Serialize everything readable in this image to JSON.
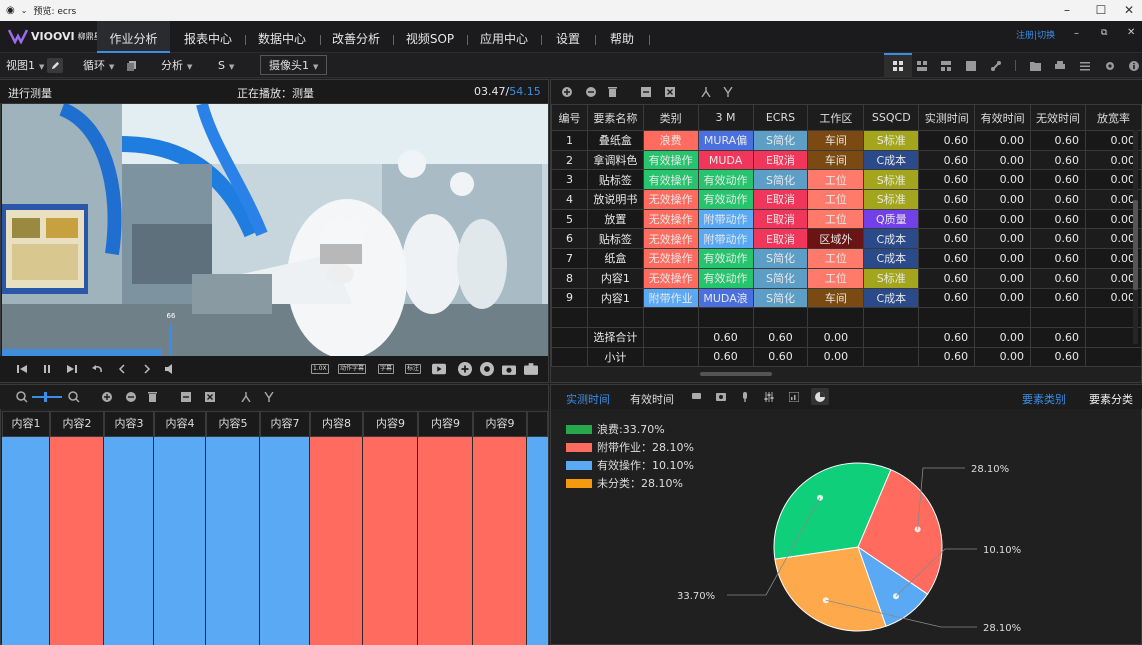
{
  "window": {
    "title": "预览: ecrs"
  },
  "app": {
    "logo_text": "VIOOVI",
    "logo_sub": "柳鼎星"
  },
  "menu": [
    "作业分析",
    "报表中心",
    "数据中心",
    "改善分析",
    "视频SOP",
    "应用中心",
    "设置",
    "帮助"
  ],
  "account": {
    "register": "注册",
    "sep": "|",
    "logout": "切换"
  },
  "toolbar": {
    "view": "视图1",
    "loop": "循环",
    "analysis": "分析",
    "s": "S",
    "camera": "摄像头1"
  },
  "video": {
    "left_label": "进行测量",
    "status": "正在播放：测量",
    "time_current": "03.47",
    "time_sep": "/",
    "time_total": "54.15",
    "scrub_value": "66",
    "speed_tag": "1.0X",
    "tags": [
      "动作字幕",
      "字幕",
      "标注"
    ]
  },
  "table": {
    "headers": [
      "编号",
      "要素名称",
      "类别",
      "3 M",
      "ECRS",
      "工作区",
      "SSQCD",
      "实测时间",
      "有效时间",
      "无效时间",
      "放宽率"
    ],
    "rows": [
      {
        "no": "1",
        "name": "叠纸盒",
        "cat": "浪费",
        "m3": "MURA偏",
        "ecrs": "S简化",
        "area": "车间",
        "ssqcd": "S标准",
        "t1": "0.60",
        "t2": "0.00",
        "t3": "0.60",
        "t4": "0.00"
      },
      {
        "no": "2",
        "name": "拿调料色",
        "cat": "有效操作",
        "m3": "MUDA",
        "ecrs": "E取消",
        "area": "车间",
        "ssqcd": "C成本",
        "t1": "0.60",
        "t2": "0.00",
        "t3": "0.60",
        "t4": "0.00"
      },
      {
        "no": "3",
        "name": "贴标签",
        "cat": "有效操作",
        "m3": "有效动作",
        "ecrs": "S简化",
        "area": "工位",
        "ssqcd": "S标准",
        "t1": "0.60",
        "t2": "0.00",
        "t3": "0.60",
        "t4": "0.00"
      },
      {
        "no": "4",
        "name": "放说明书",
        "cat": "无效操作",
        "m3": "有效动作",
        "ecrs": "E取消",
        "area": "工位",
        "ssqcd": "S标准",
        "t1": "0.60",
        "t2": "0.00",
        "t3": "0.60",
        "t4": "0.00"
      },
      {
        "no": "5",
        "name": "放置",
        "cat": "无效操作",
        "m3": "附带动作",
        "ecrs": "E取消",
        "area": "工位",
        "ssqcd": "Q质量",
        "t1": "0.60",
        "t2": "0.00",
        "t3": "0.60",
        "t4": "0.00"
      },
      {
        "no": "6",
        "name": "贴标签",
        "cat": "无效操作",
        "m3": "附带动作",
        "ecrs": "E取消",
        "area": "区域外",
        "ssqcd": "C成本",
        "t1": "0.60",
        "t2": "0.00",
        "t3": "0.60",
        "t4": "0.00"
      },
      {
        "no": "7",
        "name": "纸盒",
        "cat": "无效操作",
        "m3": "有效动作",
        "ecrs": "S简化",
        "area": "工位",
        "ssqcd": "C成本",
        "t1": "0.60",
        "t2": "0.00",
        "t3": "0.60",
        "t4": "0.00"
      },
      {
        "no": "8",
        "name": "内容1",
        "cat": "无效操作",
        "m3": "有效动作",
        "ecrs": "S简化",
        "area": "工位",
        "ssqcd": "S标准",
        "t1": "0.60",
        "t2": "0.00",
        "t3": "0.60",
        "t4": "0.00"
      },
      {
        "no": "9",
        "name": "内容1",
        "cat": "附带作业",
        "m3": "MUDA浪",
        "ecrs": "S简化",
        "area": "车间",
        "ssqcd": "C成本",
        "t1": "0.60",
        "t2": "0.00",
        "t3": "0.60",
        "t4": "0.00"
      }
    ],
    "summary": [
      {
        "label": "选择合计",
        "v3m": "0.60",
        "vecrs": "0.60",
        "varea": "0.00",
        "t1": "0.60",
        "t2": "0.00",
        "t3": "0.60"
      },
      {
        "label": "小计",
        "v3m": "0.60",
        "vecrs": "0.60",
        "varea": "0.00",
        "t1": "0.60",
        "t2": "0.00",
        "t3": "0.60"
      }
    ]
  },
  "colors": {
    "浪费": "#ff6b5e",
    "有效操作": "#27c46e",
    "无效操作": "#ff6b5e",
    "附带作业": "#5aa9f5",
    "MURA偏": "#4a70e0",
    "MUDA": "#f0365a",
    "有效动作": "#27c46e",
    "附带动作": "#5aa9f5",
    "MUDA浪": "#4a70e0",
    "S简化": "#5c9ec6",
    "E取消": "#f0365a",
    "车间": "#7a4a12",
    "工位": "#ff7a6a",
    "区域外": "#6a1414",
    "S标准": "#a3a51c",
    "C成本": "#2a4a8a",
    "Q质量": "#7240e8"
  },
  "segments": {
    "labels": [
      "内容1",
      "内容2",
      "内容3",
      "内容4",
      "内容5",
      "内容7",
      "内容8",
      "内容9",
      "内容9",
      "内容9"
    ],
    "colors": [
      "#5aa9f5",
      "#ff6b5e",
      "#5aa9f5",
      "#5aa9f5",
      "#5aa9f5",
      "#5aa9f5",
      "#ff6b5e",
      "#ff6b5e",
      "#ff6b5e",
      "#ff6b5e"
    ]
  },
  "bottom_right": {
    "tab_measured": "实测时间",
    "tab_effective": "有效时间",
    "tab_elem_cat": "要素类别",
    "tab_elem_class": "要素分类"
  },
  "chart_data": {
    "type": "pie",
    "legend": [
      {
        "label": "浪费:33.70%",
        "color": "#27a84a"
      },
      {
        "label": "附带作业：28.10%",
        "color": "#ff6b5e"
      },
      {
        "label": "有效操作：10.10%",
        "color": "#5aa9f5"
      },
      {
        "label": "未分类：28.10%",
        "color": "#f59a0c"
      }
    ],
    "slices": [
      {
        "label": "28.10%",
        "value": 28.1,
        "color": "#ff6b5e"
      },
      {
        "label": "10.10%",
        "value": 10.1,
        "color": "#5aa9f5"
      },
      {
        "label": "28.10%",
        "value": 28.1,
        "color": "#ffa94d"
      },
      {
        "label": "33.70%",
        "value": 33.7,
        "color": "#0fcf7b"
      }
    ]
  }
}
